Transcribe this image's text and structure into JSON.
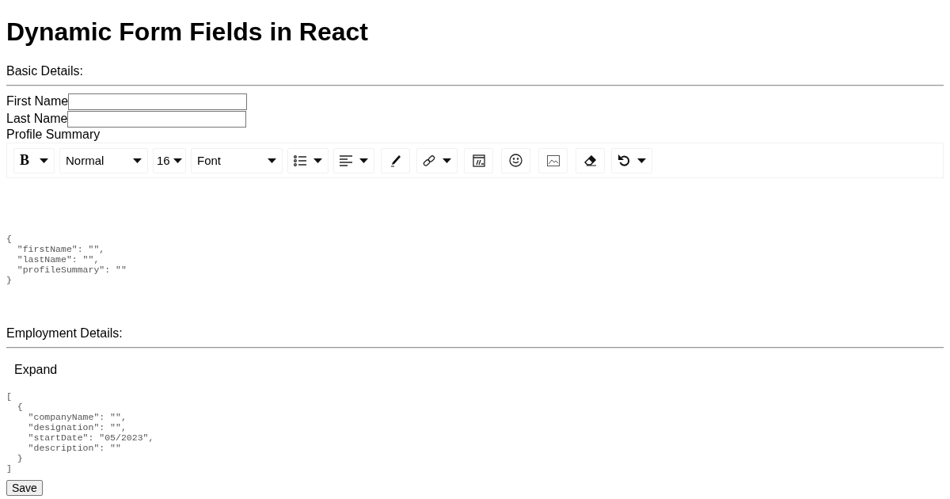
{
  "title": "Dynamic Form Fields in React",
  "sections": [
    {
      "heading": "Basic Details:",
      "fields": [
        {
          "label": "First Name"
        },
        {
          "label": "Last Name"
        }
      ],
      "editor": {
        "label": "Profile Summary",
        "toolbar": [
          {
            "kind": "text-dropdown",
            "label": "B"
          },
          {
            "kind": "text-dropdown",
            "label": "Normal"
          },
          {
            "kind": "text-dropdown",
            "label": "16"
          },
          {
            "kind": "text-dropdown",
            "label": "Font"
          },
          {
            "kind": "icon-dropdown"
          },
          {
            "kind": "icon-dropdown"
          },
          {
            "kind": "icon"
          },
          {
            "kind": "icon-dropdown"
          },
          {
            "kind": "icon"
          },
          {
            "kind": "icon"
          },
          {
            "kind": "icon"
          },
          {
            "kind": "icon"
          },
          {
            "kind": "icon-dropdown"
          }
        ]
      },
      "json_lines": [
        "{",
        "  \"firstName\": \"\",",
        "  \"lastName\": \"\",",
        "  \"profileSummary\": \"\"",
        "}"
      ]
    },
    {
      "heading": "Employment Details:",
      "expand": "Expand",
      "json_lines": [
        "[",
        "  {",
        "    \"companyName\": \"\",",
        "    \"designation\": \"\",",
        "    \"startDate\": \"05/2023\",",
        "    \"description\": \"\"",
        "  }",
        "]"
      ]
    }
  ],
  "save": "Save"
}
